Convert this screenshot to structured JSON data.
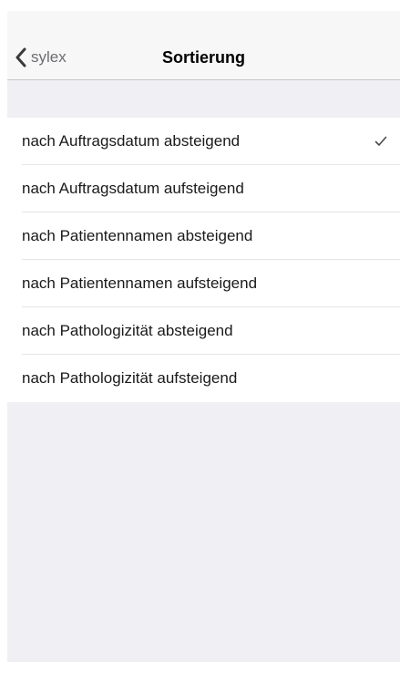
{
  "navbar": {
    "back_label": "sylex",
    "title": "Sortierung"
  },
  "sort_options": [
    {
      "label": "nach Auftragsdatum absteigend",
      "selected": true
    },
    {
      "label": "nach Auftragsdatum aufsteigend",
      "selected": false
    },
    {
      "label": "nach Patientennamen absteigend",
      "selected": false
    },
    {
      "label": "nach Patientennamen aufsteigend",
      "selected": false
    },
    {
      "label": "nach Pathologizität absteigend",
      "selected": false
    },
    {
      "label": "nach Pathologizität aufsteigend",
      "selected": false
    }
  ],
  "icons": {
    "back": "chevron-left-icon",
    "selected": "checkmark-icon"
  },
  "colors": {
    "navbar_background": "#f7f7f7",
    "page_background": "#efeff4",
    "back_label": "#6d6d72",
    "checkmark": "#4a4a4a"
  }
}
